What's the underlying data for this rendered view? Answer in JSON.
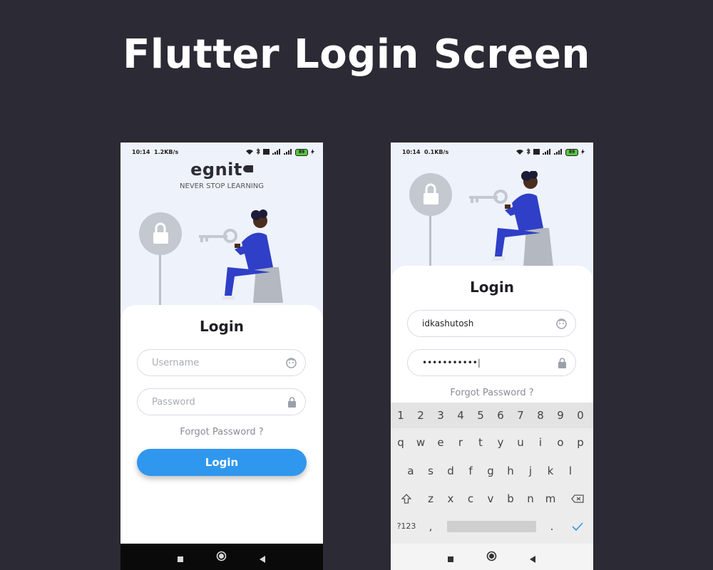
{
  "headline": "Flutter Login Screen",
  "phone_left": {
    "status": {
      "time": "10:14",
      "speed": "1.2KB/s",
      "battery": "89"
    },
    "brand": {
      "logo": "egnit",
      "tagline": "NEVER STOP LEARNING"
    },
    "title": "Login",
    "username": {
      "placeholder": "Username",
      "icon": "face-icon"
    },
    "password": {
      "placeholder": "Password",
      "icon": "lock-icon"
    },
    "forgot": "Forgot Password ?",
    "button": "Login"
  },
  "phone_right": {
    "status": {
      "time": "10:14",
      "speed": "0.1KB/s",
      "battery": "89"
    },
    "title": "Login",
    "username": {
      "value": "idkashutosh",
      "icon": "face-icon"
    },
    "password": {
      "value": "•••••••••••",
      "icon": "lock-icon"
    },
    "forgot": "Forgot Password ?",
    "keyboard": {
      "numbers": [
        "1",
        "2",
        "3",
        "4",
        "5",
        "6",
        "7",
        "8",
        "9",
        "0"
      ],
      "row1": [
        "q",
        "w",
        "e",
        "r",
        "t",
        "y",
        "u",
        "i",
        "o",
        "p"
      ],
      "row2": [
        "a",
        "s",
        "d",
        "f",
        "g",
        "h",
        "j",
        "k",
        "l"
      ],
      "row3": [
        "z",
        "x",
        "c",
        "v",
        "b",
        "n",
        "m"
      ],
      "symbols_key": "?123",
      "comma": ",",
      "period": "."
    }
  },
  "colors": {
    "background": "#2c2a34",
    "accent": "#2f97ee",
    "figure": "#2f3fc7"
  }
}
